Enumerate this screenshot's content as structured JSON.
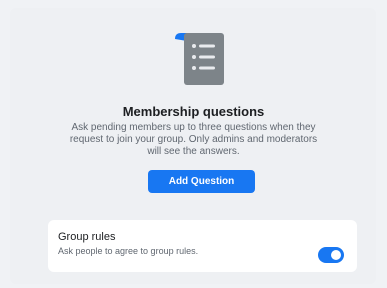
{
  "membership": {
    "icon": "document-list-icon",
    "title": "Membership questions",
    "description": "Ask pending members up to three questions when they request to join your group. Only admins and moderators will see the answers.",
    "add_button_label": "Add Question"
  },
  "group_rules": {
    "title": "Group rules",
    "description": "Ask people to agree to group rules.",
    "toggle_on": true
  },
  "colors": {
    "accent": "#1877f2",
    "icon_gray": "#7d8489",
    "background": "#f0f2f5"
  }
}
